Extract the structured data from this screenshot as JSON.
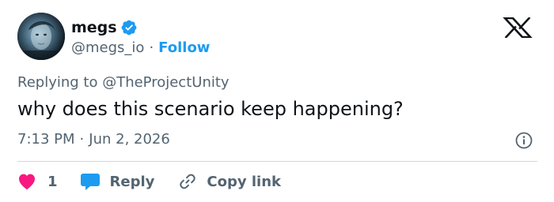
{
  "tweet": {
    "author": {
      "display_name": "megs",
      "handle": "@megs_io",
      "verified": true,
      "avatar": "profile-photo"
    },
    "follow_label": "Follow",
    "separator": "·",
    "platform_logo": "x-logo",
    "replying_prefix": "Replying to ",
    "replying_to": "@TheProjectUnity",
    "text": "why does this scenario keep happening?",
    "time": "7:13 PM",
    "date": "Jun 2, 2026",
    "info_icon": "info-icon"
  },
  "actions": {
    "like_count": "1",
    "reply_label": "Reply",
    "copy_link_label": "Copy link"
  },
  "colors": {
    "accent": "#1d9bf0",
    "like": "#f91880",
    "text_primary": "#0f1419",
    "text_secondary": "#536471",
    "divider": "#cfd9de"
  }
}
